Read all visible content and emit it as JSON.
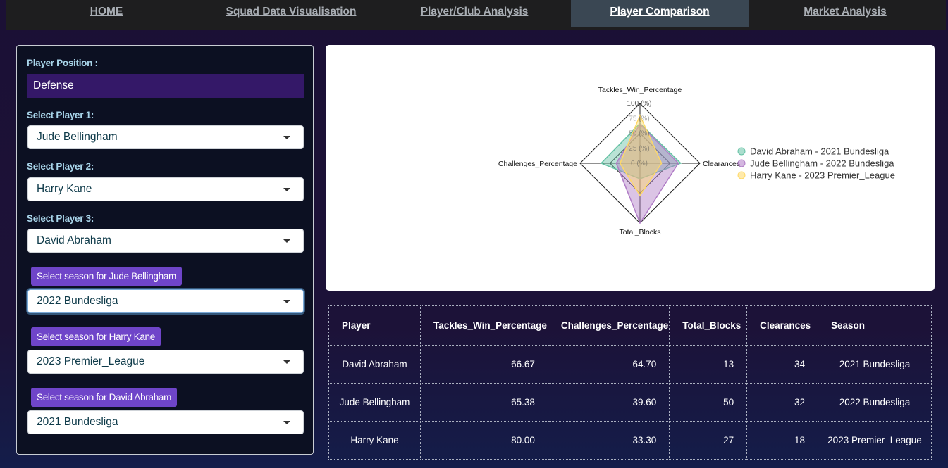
{
  "nav": {
    "tabs": [
      {
        "label": "HOME",
        "active": false
      },
      {
        "label": "Squad Data Visualisation",
        "active": false
      },
      {
        "label": "Player/Club Analysis",
        "active": false
      },
      {
        "label": "Player Comparison",
        "active": true
      },
      {
        "label": "Market Analysis",
        "active": false
      }
    ]
  },
  "sidebar": {
    "position_label": "Player Position :",
    "position_value": "Defense",
    "player1_label": "Select Player 1:",
    "player1_value": "Jude Bellingham",
    "player2_label": "Select Player 2:",
    "player2_value": "Harry Kane",
    "player3_label": "Select Player 3:",
    "player3_value": "David Abraham",
    "season1_label": "Select season for Jude Bellingham",
    "season1_value": "2022 Bundesliga",
    "season2_label": "Select season for Harry Kane",
    "season2_value": "2023 Premier_League",
    "season3_label": "Select season for David Abraham",
    "season3_value": "2021 Bundesliga"
  },
  "chart_data": {
    "type": "radar",
    "axes": [
      "Tackles_Win_Percentage",
      "Clearances",
      "Total_Blocks",
      "Challenges_Percentage"
    ],
    "tick_labels": [
      "0 (%)",
      "25 (%)",
      "50 (%)",
      "75 (%)",
      "100 (%)"
    ],
    "range": [
      0,
      100
    ],
    "legend_position": "right",
    "series": [
      {
        "name": "David Abraham - 2021 Bundesliga",
        "color": "#66c2a5",
        "values": [
          66.67,
          68,
          26,
          64.7
        ]
      },
      {
        "name": "Jude Bellingham - 2022 Bundesliga",
        "color": "#b07cc6",
        "values": [
          65.38,
          64,
          100,
          39.6
        ]
      },
      {
        "name": "Harry Kane - 2023 Premier_League",
        "color": "#ffd966",
        "values": [
          80,
          36,
          54,
          33.3
        ]
      }
    ]
  },
  "table": {
    "headers": [
      "Player",
      "Tackles_Win_Percentage",
      "Challenges_Percentage",
      "Total_Blocks",
      "Clearances",
      "Season"
    ],
    "rows": [
      [
        "David Abraham",
        "66.67",
        "64.70",
        "13",
        "34",
        "2021 Bundesliga"
      ],
      [
        "Jude Bellingham",
        "65.38",
        "39.60",
        "50",
        "32",
        "2022 Bundesliga"
      ],
      [
        "Harry Kane",
        "80.00",
        "33.30",
        "27",
        "18",
        "2023 Premier_League"
      ]
    ]
  }
}
